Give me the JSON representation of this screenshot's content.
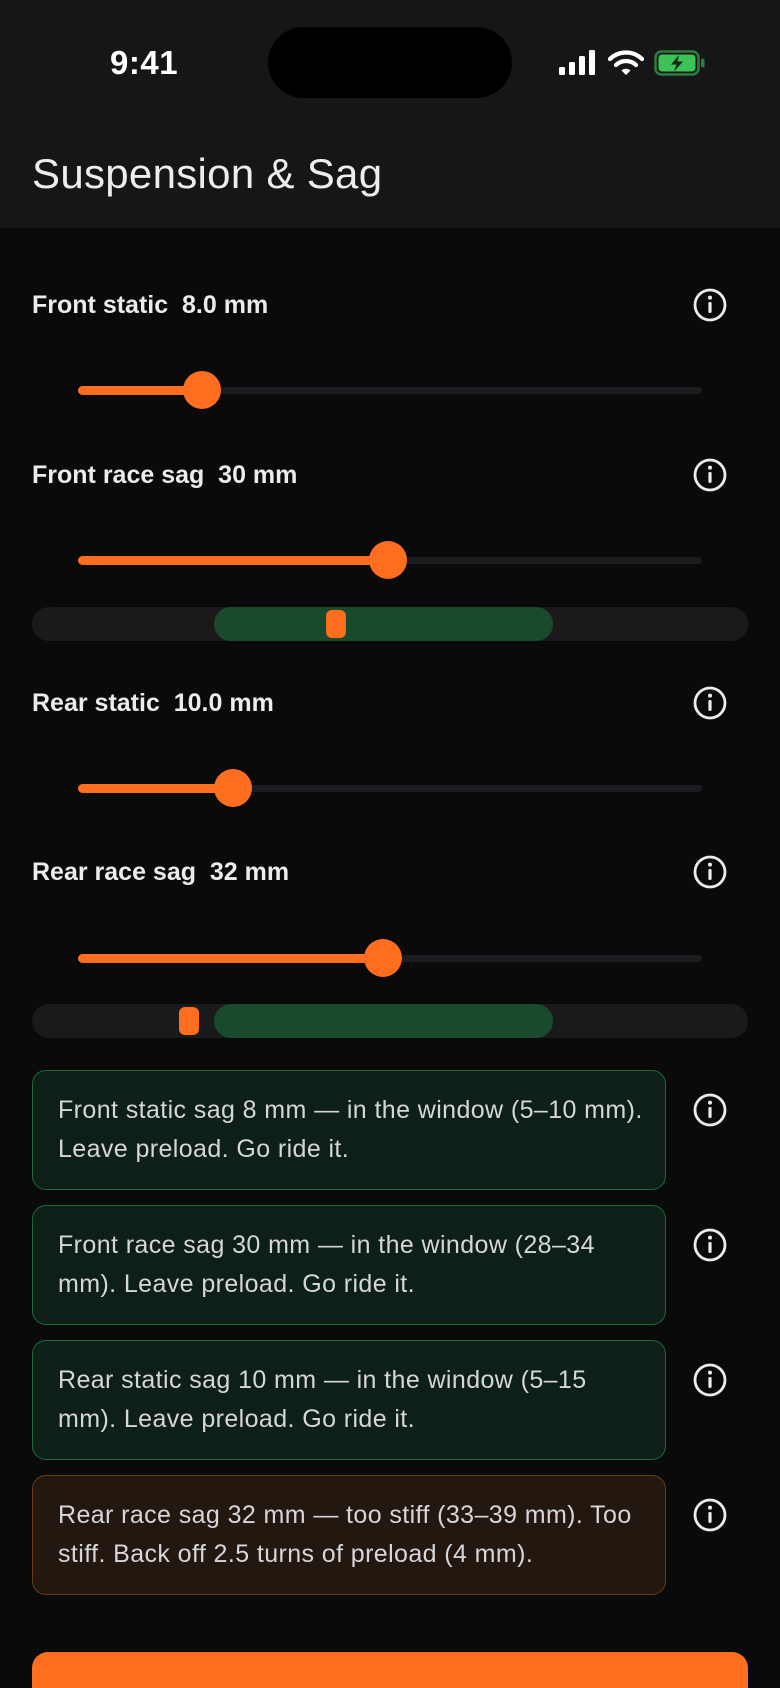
{
  "status_bar": {
    "time": "9:41"
  },
  "header": {
    "title": "Suspension & Sag"
  },
  "sliders": [
    {
      "label": "Front static  8.0 mm",
      "value_fraction": 0.198
    },
    {
      "label": "Front race sag  30 mm",
      "value_fraction": 0.497
    },
    {
      "label": "Rear static  10.0 mm",
      "value_fraction": 0.248
    },
    {
      "label": "Rear race sag  32 mm",
      "value_fraction": 0.488
    }
  ],
  "gauges": {
    "front_race": {
      "window_start_fraction": 0.254,
      "window_end_fraction": 0.728,
      "marker_fraction": 0.425
    },
    "rear_race": {
      "window_start_fraction": 0.254,
      "window_end_fraction": 0.728,
      "marker_fraction": 0.219
    }
  },
  "advice": [
    {
      "text": "Front static sag 8 mm — in the window (5–10 mm). Leave preload. Go ride it.",
      "status": "ok"
    },
    {
      "text": "Front race sag 30 mm — in the window (28–34 mm). Leave preload. Go ride it.",
      "status": "ok"
    },
    {
      "text": "Rear static sag 10 mm — in the window (5–15 mm). Leave preload. Go ride it.",
      "status": "ok"
    },
    {
      "text": "Rear race sag 32 mm — too stiff (33–39 mm). Too stiff. Back off 2.5 turns of preload (4 mm).",
      "status": "warn"
    }
  ],
  "icons": {
    "info": "info-icon",
    "signal": "cellular-signal-icon",
    "wifi": "wifi-icon",
    "battery": "battery-charging-icon"
  },
  "colors": {
    "accent": "#ff6d1f",
    "ok_bg": "#0d1f16",
    "ok_border": "#1c6a3b",
    "warn_bg": "#231810",
    "warn_border": "#6b3b12",
    "window_green": "#1a4a2c"
  }
}
